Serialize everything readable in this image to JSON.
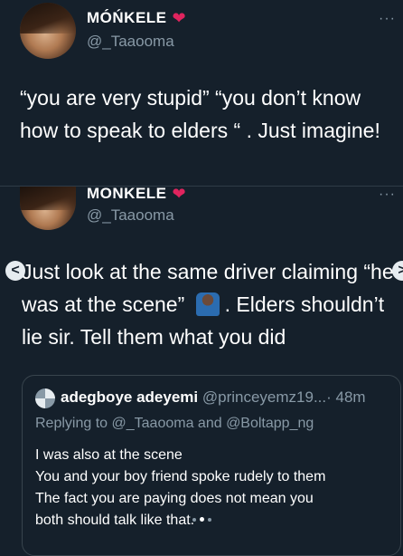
{
  "tweet1": {
    "display_name": "MÓŃKELE",
    "handle": "@_Taaooma",
    "text": "“you are very stupid” “you don’t know how to speak to elders “ . Just imagine!",
    "more": "···"
  },
  "tweet2": {
    "display_name": "MONKELE",
    "handle": "@_Taaooma",
    "text_before_emoji": "Just look at the same driver claiming “he was at the scene” ",
    "text_after_emoji": ". Elders shouldn’t lie sir. Tell them what you did",
    "more": "···"
  },
  "quote": {
    "name": "adegboye adeyemi",
    "handle": "@princeyemz19...",
    "time": "· 48m",
    "replying_prefix": "Replying to ",
    "reply_user1": "@_Taaooma",
    "reply_and": " and ",
    "reply_user2": "@Boltapp_ng",
    "lines": [
      "I was also at the scene",
      "You and your boy friend spoke rudely to them",
      "The fact you are paying does not mean you",
      "both should talk like that."
    ]
  },
  "carousel": {
    "prev_label": "<",
    "next_label": ">",
    "dots": 3,
    "active_dot": 1
  },
  "icons": {
    "heart": "red-heart-icon",
    "emoji": "man-facepalm-emoji",
    "more": "more-options-icon"
  },
  "colors": {
    "background": "#15202b",
    "secondary_text": "#8899a6",
    "heart": "#e0245e",
    "border": "#38444d"
  }
}
